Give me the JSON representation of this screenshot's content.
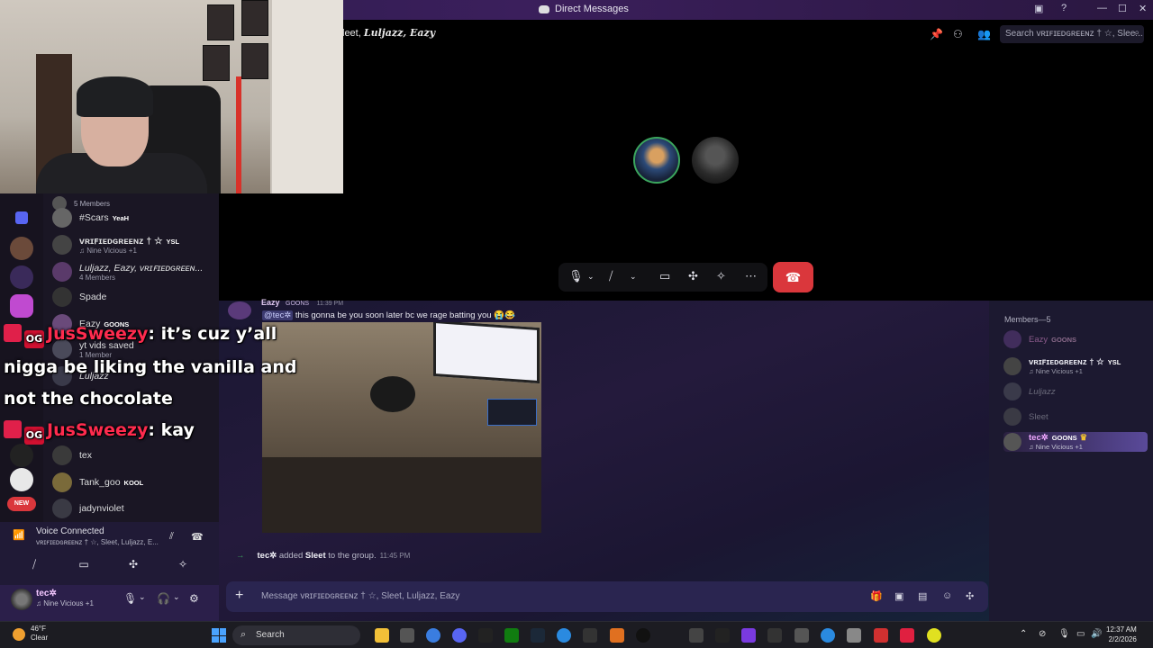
{
  "window": {
    "title": "Direct Messages",
    "controls": [
      "minimize-icon",
      "maximize-icon",
      "close-icon"
    ]
  },
  "call": {
    "header": "leet, ",
    "header_names": "Luljazz, Eazy",
    "search_placeholder": "Search ᴠʀɪꜰɪᴇᴅɢʀᴇᴇɴᴢ † ☆, Slee...",
    "controls": [
      "mic-icon",
      "camera-off-icon",
      "share-screen-icon",
      "activities-icon",
      "soundboard-icon",
      "more-icon"
    ]
  },
  "dm_list": [
    {
      "name": "",
      "sub": "5 Members"
    },
    {
      "name": "#Scars",
      "tag": "YeaH"
    },
    {
      "name": "ᴠʀɪꜰɪᴇᴅɢʀᴇᴇɴᴢ † ☆",
      "tag": "YSL",
      "sub": "♫ Nine Vicious +1"
    },
    {
      "name": "Luljazz, Eazy, ᴠʀɪꜰɪᴇᴅɢʀᴇᴇɴ...",
      "sub": "4 Members"
    },
    {
      "name": "Spade"
    },
    {
      "name": "Eazy",
      "tag": "GOONS"
    },
    {
      "name": "yt vids saved",
      "sub": "1 Member"
    },
    {
      "name": "Luljazz"
    },
    {
      "name": "tex"
    },
    {
      "name": "Tank_goo",
      "tag": "KOOL"
    },
    {
      "name": "jadynviolet"
    }
  ],
  "voice": {
    "status": "Voice Connected",
    "channel": "ᴠʀɪꜰɪᴇᴅɢʀᴇᴇɴᴢ † ☆, Sleet, Luljazz, E..."
  },
  "user": {
    "name": "tec✲",
    "status": "♫ Nine Vicious +1"
  },
  "message": {
    "author": "Eazy",
    "tag": "GOONS",
    "time": "11:39 PM",
    "mention": "@tec✲",
    "text": " this gonna be you soon later bc we rage batting you 😭😂"
  },
  "system_message": {
    "actor": "tec✲",
    "verb": " added ",
    "target": "Sleet",
    "rest": " to the group.",
    "time": "11:45 PM"
  },
  "composer": {
    "placeholder": "Message ᴠʀɪꜰɪᴇᴅɢʀᴇᴇɴᴢ † ☆, Sleet, Luljazz, Eazy"
  },
  "members": {
    "header": "Members—5",
    "list": [
      {
        "name": "Eazy",
        "tag": "GOONS",
        "color": "#8a5a8a"
      },
      {
        "name": "ᴠʀɪꜰɪᴇᴅɢʀᴇᴇɴᴢ † ☆",
        "tag": "YSL",
        "sub": "♫ Nine Vicious +1",
        "color": "#e8e8f0"
      },
      {
        "name": "Luljazz",
        "color": "#6a6a7a"
      },
      {
        "name": "Sleet",
        "color": "#6a6a7a"
      },
      {
        "name": "tec✲",
        "tag": "GOONS",
        "sub": "♫ Nine Vicious +1",
        "color": "#f0a8ff"
      }
    ]
  },
  "overlay": {
    "nick1": "JusSweezy",
    "line1": ": it’s cuz y’all",
    "line2": "nigga be liking the vanilla and",
    "line3": "not the chocolate",
    "nick2": "JusSweezy",
    "line4": ": kay",
    "badge": "OG"
  },
  "taskbar": {
    "temp": "46°F",
    "weather": "Clear",
    "search": "Search",
    "time": "12:37 AM",
    "date": "2/2/2026"
  },
  "colors": {
    "accent": "#5865f2",
    "hangup": "#da373c",
    "online": "#3ba55d",
    "overlay_nick": "#ff2b4e"
  }
}
